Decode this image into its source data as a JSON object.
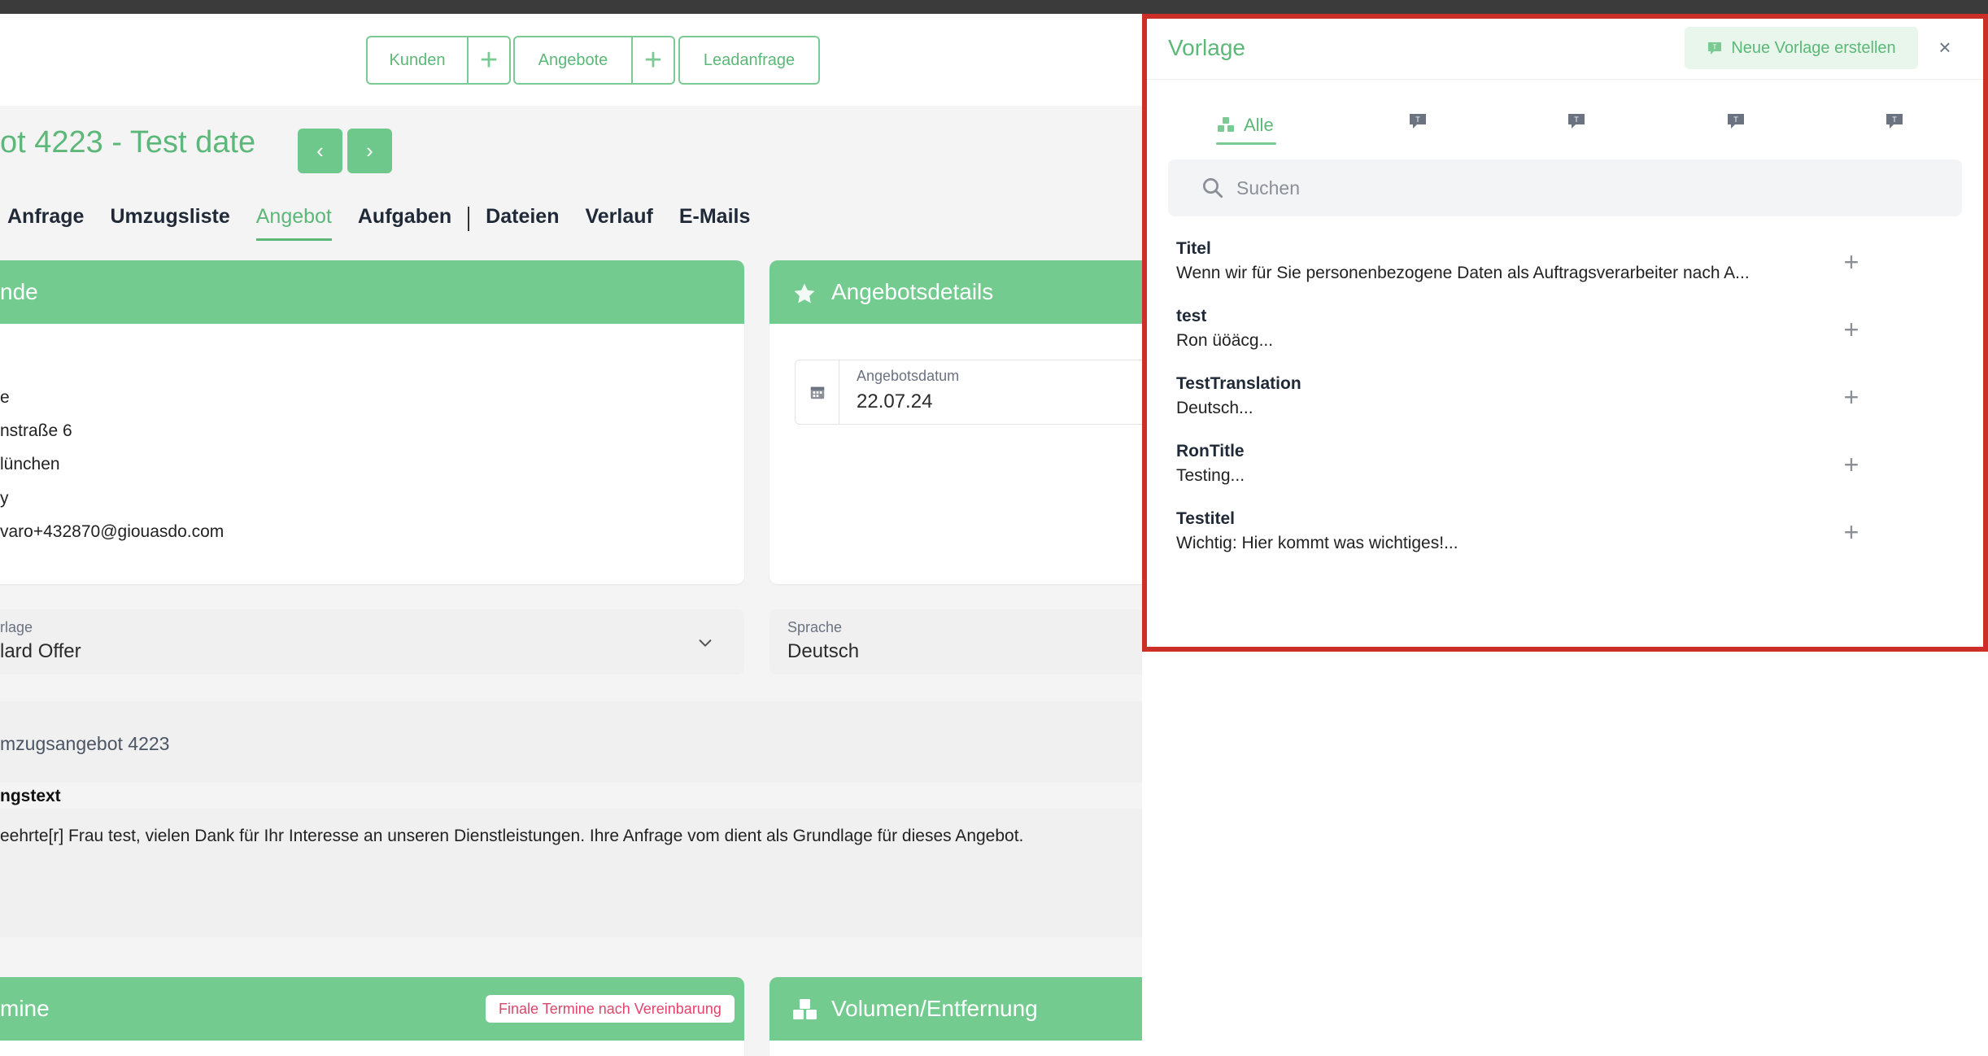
{
  "nav": {
    "kunden": "Kunden",
    "angebote": "Angebote",
    "leadanfrage": "Leadanfrage",
    "plus": "+"
  },
  "offer": {
    "title": "ot 4223 - Test date",
    "prev": "‹",
    "next": "›"
  },
  "tabs": [
    "Anfrage",
    "Umzugsliste",
    "Angebot",
    "Aufgaben",
    "Dateien",
    "Verlauf",
    "E-Mails"
  ],
  "tabs_active": "Angebot",
  "customer_card": {
    "header": "nde",
    "lines": [
      "e",
      "nstraße 6",
      "lünchen",
      "y",
      "varo+432870@giouasdo.com"
    ]
  },
  "details_card": {
    "header": "Angebotsdetails",
    "date_label": "Angebotsdatum",
    "date_value": "22.07.24"
  },
  "template_field": {
    "label": "rlage",
    "value": "lard Offer"
  },
  "language_field": {
    "label": "Sprache",
    "value": "Deutsch"
  },
  "offer_subject": "mzugsangebot 4223",
  "intro": {
    "label": "ngstext",
    "text": "eehrte[r] Frau test, vielen Dank für Ihr Interesse an unseren Dienstleistungen. Ihre Anfrage vom dient als Grundlage für dieses Angebot."
  },
  "termine_card": {
    "header": "mine",
    "badge": "Finale Termine nach Vereinbarung"
  },
  "volume_card": {
    "header": "Volumen/Entfernung"
  },
  "panel": {
    "title": "Vorlage",
    "new_button": "Neue Vorlage erstellen",
    "close": "×",
    "tab_all": "Alle",
    "search_placeholder": "Suchen",
    "templates": [
      {
        "title": "Titel",
        "text": "Wenn wir für Sie personenbezogene Daten als Auftragsverarbeiter nach A..."
      },
      {
        "title": "test",
        "text": "Ron üöäcg..."
      },
      {
        "title": "TestTranslation",
        "text": "Deutsch..."
      },
      {
        "title": "RonTitle",
        "text": "Testing..."
      },
      {
        "title": "Testitel",
        "text": "Wichtig: Hier kommt was wichtiges!..."
      }
    ],
    "add": "+"
  },
  "colors": {
    "accent": "#5cb879",
    "card_header": "#74cb8f",
    "highlight_frame": "#cc2f27",
    "badge_text": "#e0456b"
  }
}
